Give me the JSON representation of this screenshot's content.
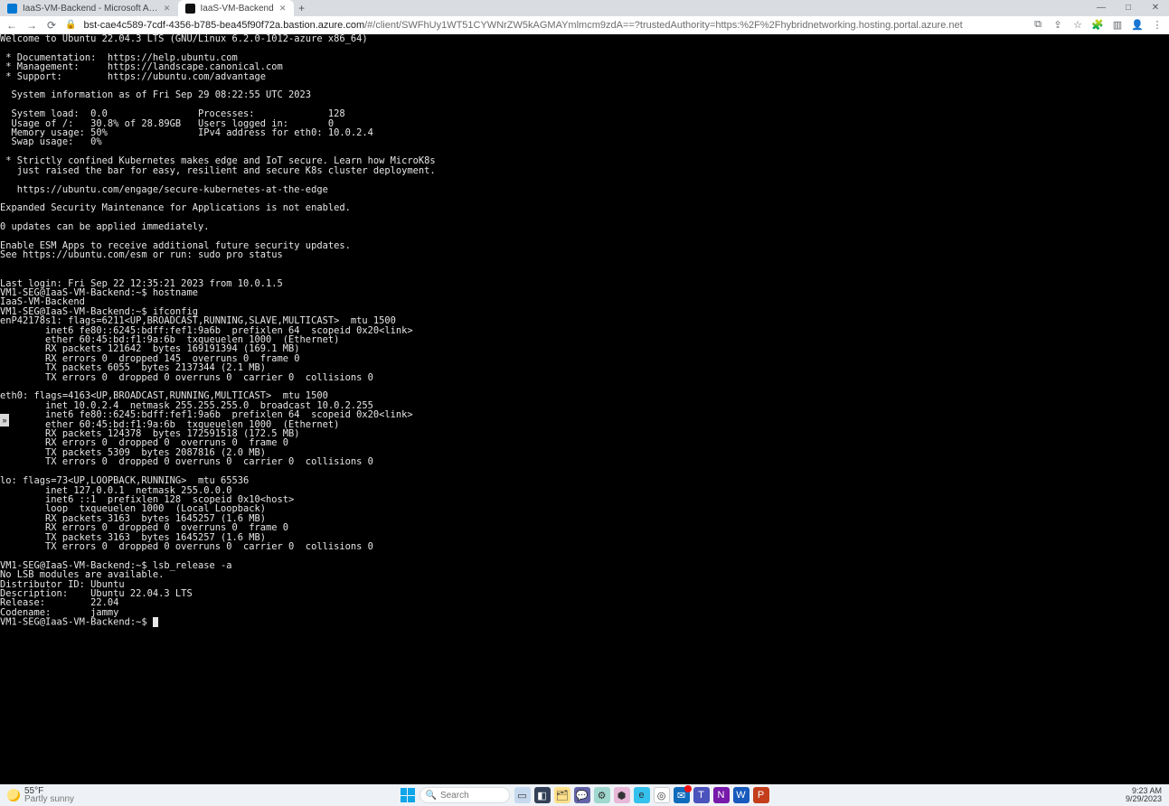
{
  "window": {
    "minimize": "—",
    "maximize": "□",
    "close": "✕"
  },
  "tabs": [
    {
      "title": "IaaS-VM-Backend - Microsoft A…",
      "active": false,
      "favicon": "azure"
    },
    {
      "title": "IaaS-VM-Backend",
      "active": true,
      "favicon": "terminal"
    }
  ],
  "newtab_glyph": "+",
  "nav": {
    "back": "←",
    "forward": "→",
    "reload": "⟳"
  },
  "address": {
    "lock_glyph": "🔒",
    "host": "bst-cae4c589-7cdf-4356-b785-bea45f90f72a.bastion.azure.com",
    "path": "/#/client/SWFhUy1WT51CYWNrZW5kAGMAYmlmcm9zdA==?trustedAuthority=https:%2F%2Fhybridnetworking.hosting.portal.azure.net"
  },
  "toolbar_icons": [
    "⧉",
    "⇪",
    "☆",
    "🧩",
    "▥",
    "👤",
    "⋮"
  ],
  "terminal": {
    "prompt_user_host": "VM1-SEG@IaaS-VM-Backend:~$ ",
    "lines": [
      "Welcome to Ubuntu 22.04.3 LTS (GNU/Linux 6.2.0-1012-azure x86_64)",
      "",
      " * Documentation:  https://help.ubuntu.com",
      " * Management:     https://landscape.canonical.com",
      " * Support:        https://ubuntu.com/advantage",
      "",
      "  System information as of Fri Sep 29 08:22:55 UTC 2023",
      "",
      "  System load:  0.0                Processes:             128",
      "  Usage of /:   30.8% of 28.89GB   Users logged in:       0",
      "  Memory usage: 50%                IPv4 address for eth0: 10.0.2.4",
      "  Swap usage:   0%",
      "",
      " * Strictly confined Kubernetes makes edge and IoT secure. Learn how MicroK8s",
      "   just raised the bar for easy, resilient and secure K8s cluster deployment.",
      "",
      "   https://ubuntu.com/engage/secure-kubernetes-at-the-edge",
      "",
      "Expanded Security Maintenance for Applications is not enabled.",
      "",
      "0 updates can be applied immediately.",
      "",
      "Enable ESM Apps to receive additional future security updates.",
      "See https://ubuntu.com/esm or run: sudo pro status",
      "",
      "",
      "Last login: Fri Sep 22 12:35:21 2023 from 10.0.1.5",
      "VM1-SEG@IaaS-VM-Backend:~$ hostname",
      "IaaS-VM-Backend",
      "VM1-SEG@IaaS-VM-Backend:~$ ifconfig",
      "enP42178s1: flags=6211<UP,BROADCAST,RUNNING,SLAVE,MULTICAST>  mtu 1500",
      "        inet6 fe80::6245:bdff:fef1:9a6b  prefixlen 64  scopeid 0x20<link>",
      "        ether 60:45:bd:f1:9a:6b  txqueuelen 1000  (Ethernet)",
      "        RX packets 121642  bytes 169191394 (169.1 MB)",
      "        RX errors 0  dropped 145  overruns 0  frame 0",
      "        TX packets 6055  bytes 2137344 (2.1 MB)",
      "        TX errors 0  dropped 0 overruns 0  carrier 0  collisions 0",
      "",
      "eth0: flags=4163<UP,BROADCAST,RUNNING,MULTICAST>  mtu 1500",
      "        inet 10.0.2.4  netmask 255.255.255.0  broadcast 10.0.2.255",
      "        inet6 fe80::6245:bdff:fef1:9a6b  prefixlen 64  scopeid 0x20<link>",
      "        ether 60:45:bd:f1:9a:6b  txqueuelen 1000  (Ethernet)",
      "        RX packets 124378  bytes 172591518 (172.5 MB)",
      "        RX errors 0  dropped 0  overruns 0  frame 0",
      "        TX packets 5309  bytes 2087816 (2.0 MB)",
      "        TX errors 0  dropped 0 overruns 0  carrier 0  collisions 0",
      "",
      "lo: flags=73<UP,LOOPBACK,RUNNING>  mtu 65536",
      "        inet 127.0.0.1  netmask 255.0.0.0",
      "        inet6 ::1  prefixlen 128  scopeid 0x10<host>",
      "        loop  txqueuelen 1000  (Local Loopback)",
      "        RX packets 3163  bytes 1645257 (1.6 MB)",
      "        RX errors 0  dropped 0  overruns 0  frame 0",
      "        TX packets 3163  bytes 1645257 (1.6 MB)",
      "        TX errors 0  dropped 0 overruns 0  carrier 0  collisions 0",
      "",
      "VM1-SEG@IaaS-VM-Backend:~$ lsb_release -a",
      "No LSB modules are available.",
      "Distributor ID: Ubuntu",
      "Description:    Ubuntu 22.04.3 LTS",
      "Release:        22.04",
      "Codename:       jammy"
    ]
  },
  "expand_handle_glyph": "»",
  "taskbar": {
    "weather": {
      "temp": "55°F",
      "desc": "Partly sunny"
    },
    "search_placeholder": "Search",
    "pinned": [
      {
        "name": "task-view",
        "cls": "i-task",
        "glyph": "▭"
      },
      {
        "name": "copilot",
        "cls": "i-files",
        "glyph": "◧"
      },
      {
        "name": "file-explorer",
        "cls": "i-explorer",
        "glyph": "🗂"
      },
      {
        "name": "chat",
        "cls": "i-chat",
        "glyph": "💬"
      },
      {
        "name": "settings",
        "cls": "i-settings",
        "glyph": "⚙"
      },
      {
        "name": "store",
        "cls": "i-store",
        "glyph": "⬢"
      },
      {
        "name": "edge",
        "cls": "i-edge",
        "glyph": "e"
      },
      {
        "name": "chrome",
        "cls": "i-chrome",
        "glyph": "◎"
      },
      {
        "name": "outlook",
        "cls": "i-outlook",
        "glyph": "✉",
        "badge": "●"
      },
      {
        "name": "teams",
        "cls": "i-teams",
        "glyph": "T"
      },
      {
        "name": "onenote",
        "cls": "i-onenote",
        "glyph": "N"
      },
      {
        "name": "word",
        "cls": "i-word",
        "glyph": "W"
      },
      {
        "name": "powerpoint",
        "cls": "i-ppt",
        "glyph": "P"
      }
    ],
    "clock": {
      "time": "9:23 AM",
      "date": "9/29/2023"
    }
  }
}
